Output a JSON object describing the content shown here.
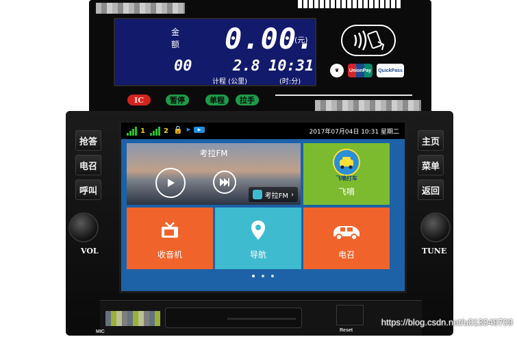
{
  "meter": {
    "label_amount_1": "金",
    "label_amount_2": "额",
    "amount": "0.00.",
    "unit_yuan": "(元)",
    "digits_left": "00",
    "distance": "2.8",
    "time": "10:31",
    "label_meter_km": "计程 (公里)",
    "label_time": "(时:分)",
    "buttons": [
      "IC",
      "暂停",
      "单程",
      "拉手"
    ],
    "card_logos": [
      "UnionPay",
      "QuickPass"
    ]
  },
  "head_unit": {
    "left_buttons": [
      "抢答",
      "电召",
      "呼叫"
    ],
    "right_buttons": [
      "主页",
      "菜单",
      "返回"
    ],
    "vol_label": "VOL",
    "tune_label": "TUNE",
    "mic_label": "MIC",
    "reset_label": "Reset"
  },
  "status_bar": {
    "sim1": "1",
    "sim2": "2",
    "datetime": "2017年07月04日  10:31 星期二"
  },
  "tiles": {
    "kaola_title": "考拉FM",
    "kaola_button": "考拉FM",
    "feidi_logo": "飞嘀打车",
    "feidi": "飞嘀",
    "radio": "收音机",
    "navigation": "导航",
    "dispatch": "电召"
  },
  "watermark": "https://blog.csdn.net/u013049709",
  "colors": {
    "lcd_bg": "#121a6b",
    "home_bg": "#1d61a6",
    "tile_orange": "#f0642c",
    "tile_green": "#7cbb2f",
    "tile_cyan": "#3fbbd0",
    "signal_green": "#27c12d"
  }
}
